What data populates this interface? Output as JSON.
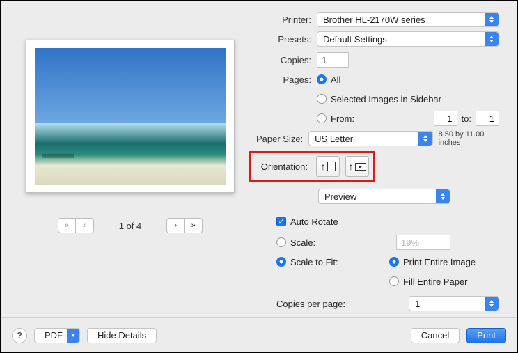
{
  "printer": {
    "label": "Printer:",
    "value": "Brother HL-2170W series"
  },
  "presets": {
    "label": "Presets:",
    "value": "Default Settings"
  },
  "copies": {
    "label": "Copies:",
    "value": "1"
  },
  "pages": {
    "label": "Pages:",
    "all": "All",
    "sidebar": "Selected Images in Sidebar",
    "from": "From:",
    "from_val": "1",
    "to": "to:",
    "to_val": "1",
    "selected": "all"
  },
  "paper_size": {
    "label": "Paper Size:",
    "value": "US Letter",
    "dims": "8.50 by 11.00 inches"
  },
  "orientation": {
    "label": "Orientation:"
  },
  "section_select": {
    "value": "Preview"
  },
  "auto_rotate": {
    "label": "Auto Rotate",
    "checked": true
  },
  "scale": {
    "label": "Scale:",
    "value": "19%"
  },
  "scale_to_fit": {
    "label": "Scale to Fit:",
    "opt_entire_image": "Print Entire Image",
    "opt_fill_paper": "Fill Entire Paper",
    "selected": "entire_image"
  },
  "copies_per_page": {
    "label": "Copies per page:",
    "value": "1"
  },
  "paginator": {
    "text": "1 of 4"
  },
  "footer": {
    "pdf": "PDF",
    "hide_details": "Hide Details",
    "cancel": "Cancel",
    "print": "Print",
    "help": "?"
  }
}
